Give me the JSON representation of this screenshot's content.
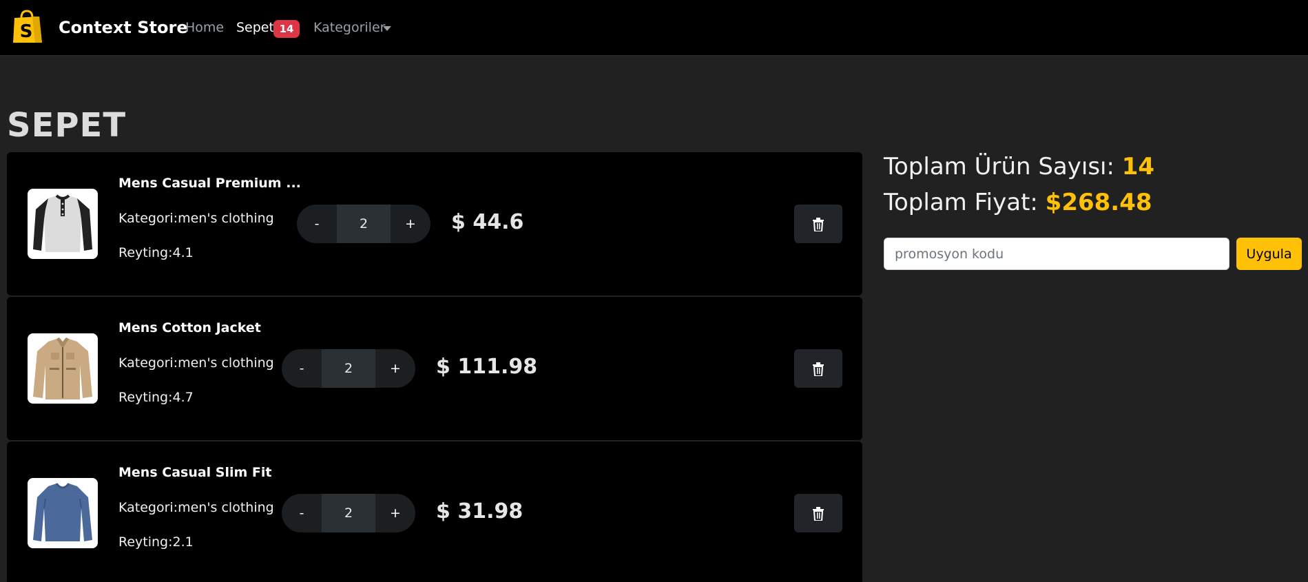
{
  "navbar": {
    "brand": "Context Store",
    "home": "Home",
    "cart": "Sepet",
    "cart_count": "14",
    "categories": "Kategoriler"
  },
  "page_title": "SEPET",
  "items": [
    {
      "title": "Mens Casual Premium ...",
      "category": "Kategori:men's clothing",
      "rating": "Reyting:4.1",
      "qty": "2",
      "price": "$ 44.6",
      "minus": "-",
      "plus": "+",
      "image": "henley-shirt"
    },
    {
      "title": "Mens Cotton Jacket",
      "category": "Kategori:men's clothing",
      "rating": "Reyting:4.7",
      "qty": "2",
      "price": "$ 111.98",
      "minus": "-",
      "plus": "+",
      "image": "cotton-jacket"
    },
    {
      "title": "Mens Casual Slim Fit",
      "category": "Kategori:men's clothing",
      "rating": "Reyting:2.1",
      "qty": "2",
      "price": "$ 31.98",
      "minus": "-",
      "plus": "+",
      "image": "slim-fit-tee"
    }
  ],
  "summary": {
    "count_label": "Toplam Ürün Sayısı: ",
    "count_value": "14",
    "total_label": "Toplam Fiyat: ",
    "total_value": "$268.48"
  },
  "promo": {
    "placeholder": "promosyon kodu",
    "button": "Uygula"
  },
  "colors": {
    "accent": "#ffc107",
    "badge": "#dc3545",
    "navbar_bg": "#000000",
    "page_bg": "#212121"
  }
}
